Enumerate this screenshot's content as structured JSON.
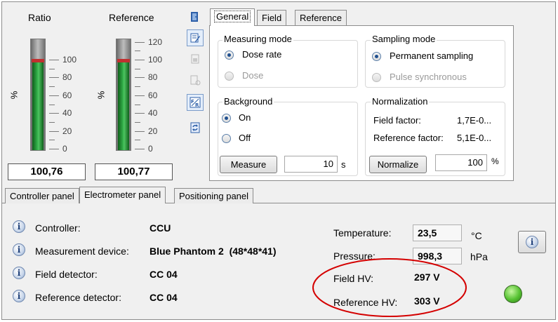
{
  "gauges": {
    "ratio": {
      "title": "Ratio",
      "unit": "%",
      "ticks": [
        "100",
        "80",
        "60",
        "40",
        "20",
        "0"
      ],
      "value": "100,76",
      "fill_percent": 100.76
    },
    "reference": {
      "title": "Reference",
      "unit": "%",
      "ticks": [
        "120",
        "100",
        "80",
        "60",
        "40",
        "20",
        "0"
      ],
      "value": "100,77",
      "fill_percent": 100.77
    }
  },
  "toolbar": {
    "icons": [
      "door-icon",
      "edit-pencil-icon",
      "lock-icon",
      "lock-settings-icon",
      "field-reference-icon",
      "refresh-icon"
    ]
  },
  "tabs": [
    "General",
    "Field",
    "Reference"
  ],
  "measuring_mode": {
    "title": "Measuring mode",
    "options": [
      "Dose rate",
      "Dose"
    ],
    "selected": "Dose rate"
  },
  "sampling_mode": {
    "title": "Sampling mode",
    "options": [
      "Permanent sampling",
      "Pulse synchronous"
    ],
    "selected": "Permanent sampling"
  },
  "background": {
    "title": "Background",
    "options": [
      "On",
      "Off"
    ],
    "selected": "On",
    "measure_label": "Measure",
    "time_value": "10",
    "time_unit": "s"
  },
  "normalization": {
    "title": "Normalization",
    "field_factor_label": "Field factor:",
    "field_factor_value": "1,7E-0...",
    "reference_factor_label": "Reference factor:",
    "reference_factor_value": "5,1E-0...",
    "normalize_label": "Normalize",
    "percent_value": "100",
    "percent_unit": "%"
  },
  "bottom_tabs": [
    "Controller panel",
    "Electrometer panel",
    "Positioning panel"
  ],
  "status": {
    "controller_label": "Controller:",
    "controller_value": "CCU",
    "device_label": "Measurement device:",
    "device_value": "Blue Phantom 2  (48*48*41)",
    "field_detector_label": "Field detector:",
    "field_detector_value": "CC 04",
    "reference_detector_label": "Reference detector:",
    "reference_detector_value": "CC 04",
    "temperature_label": "Temperature:",
    "temperature_value": "23,5",
    "temperature_unit": "°C",
    "pressure_label": "Pressure:",
    "pressure_value": "998,3",
    "pressure_unit": "hPa",
    "field_hv_label": "Field HV:",
    "field_hv_value": "297 V",
    "reference_hv_label": "Reference HV:",
    "reference_hv_value": "303 V"
  },
  "colors": {
    "highlight_ellipse": "#d40000",
    "led": "#56c232",
    "gauge_fill": "#33b04a"
  }
}
